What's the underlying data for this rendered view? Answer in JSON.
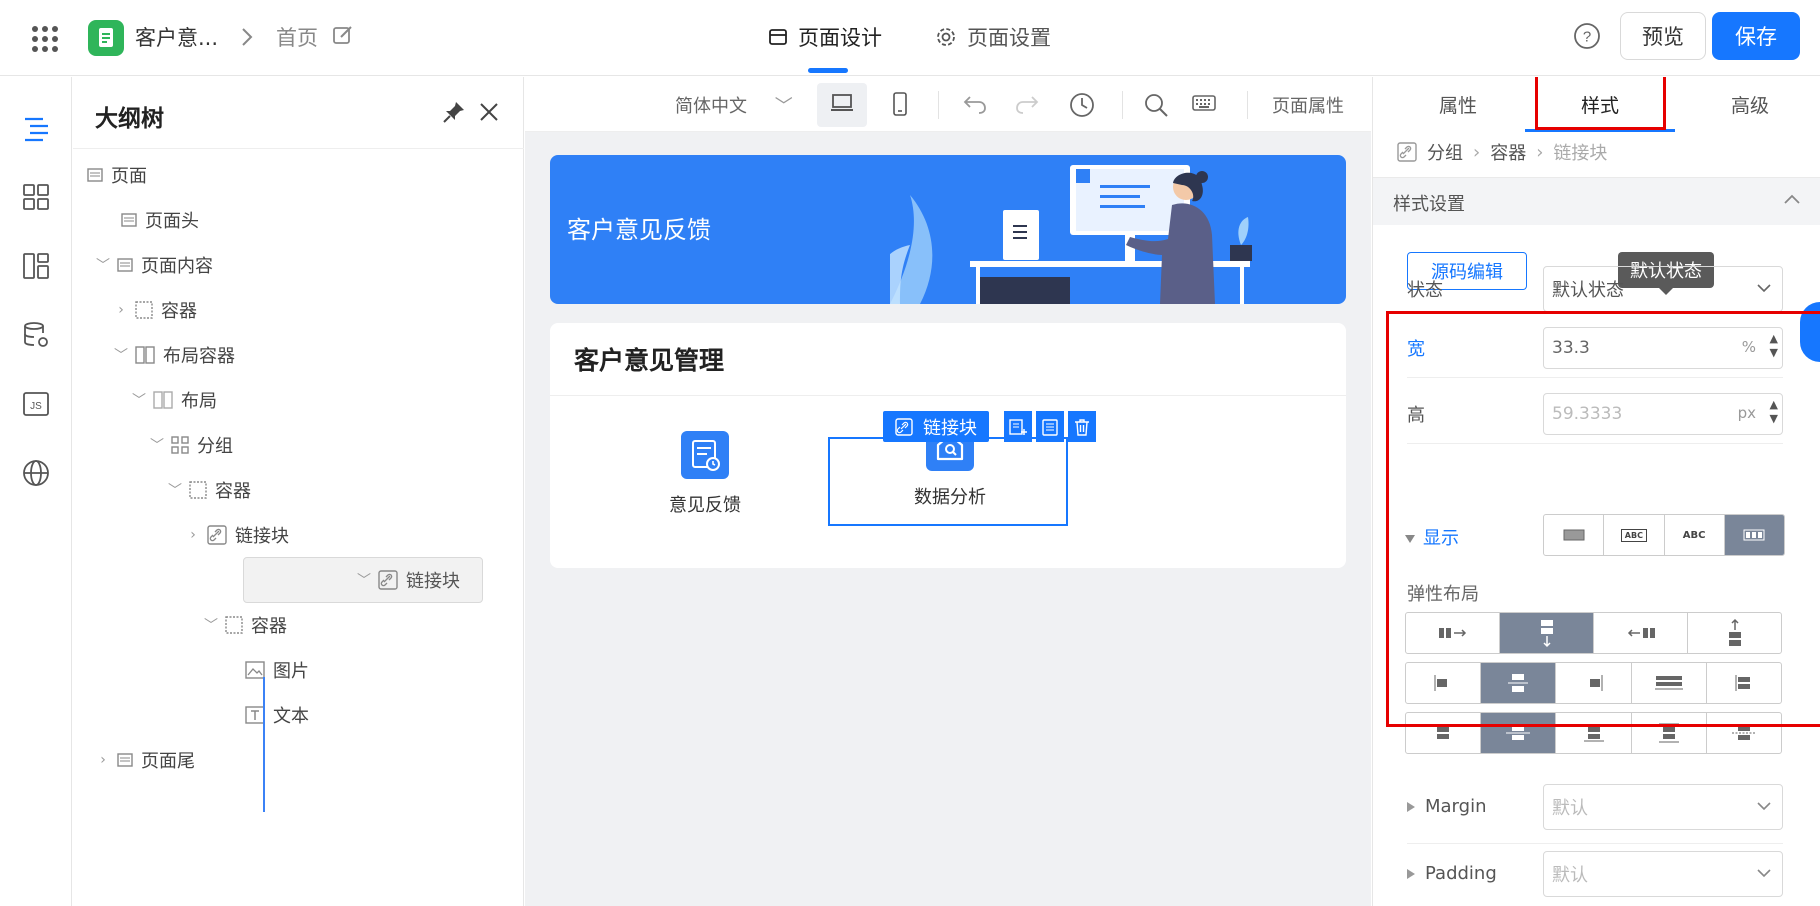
{
  "header": {
    "app_name": "客户意...",
    "breadcrumb_home": "首页",
    "tab_design": "页面设计",
    "tab_settings": "页面设置",
    "preview_label": "预览",
    "save_label": "保存"
  },
  "outline": {
    "title": "大纲树",
    "items": [
      {
        "label": "页面"
      },
      {
        "label": "页面头"
      },
      {
        "label": "页面内容"
      },
      {
        "label": "容器"
      },
      {
        "label": "布局容器"
      },
      {
        "label": "布局"
      },
      {
        "label": "分组"
      },
      {
        "label": "容器"
      },
      {
        "label": "链接块"
      },
      {
        "label": "链接块"
      },
      {
        "label": "容器"
      },
      {
        "label": "图片"
      },
      {
        "label": "文本"
      },
      {
        "label": "页面尾"
      }
    ]
  },
  "canvas": {
    "language": "简体中文",
    "page_props": "页面属性",
    "banner_title": "客户意见反馈",
    "card_title": "客户意见管理",
    "link_a": "意见反馈",
    "link_b": "数据分析",
    "selected_tag": "链接块"
  },
  "right_panel": {
    "tabs": [
      "属性",
      "样式",
      "高级"
    ],
    "active_tab": "样式",
    "breadcrumb": [
      "分组",
      "容器",
      "链接块"
    ],
    "section_title": "样式设置",
    "source_edit": "源码编辑",
    "tooltip": "默认状态",
    "state_label": "状态",
    "state_value": "默认状态",
    "width_label": "宽",
    "width_value": "33.3",
    "width_unit": "%",
    "height_label": "高",
    "height_value": "59.3333",
    "height_unit": "px",
    "display_label": "显示",
    "display_options": [
      "",
      "ABC",
      "ABC",
      ""
    ],
    "flex_label": "弹性布局",
    "margin_label": "Margin",
    "margin_value": "默认",
    "padding_label": "Padding",
    "padding_value": "默认"
  },
  "colors": {
    "accent": "#1677ff",
    "banner": "#2f80f6",
    "save": "#1677ff",
    "highlight_border": "#e60000"
  }
}
